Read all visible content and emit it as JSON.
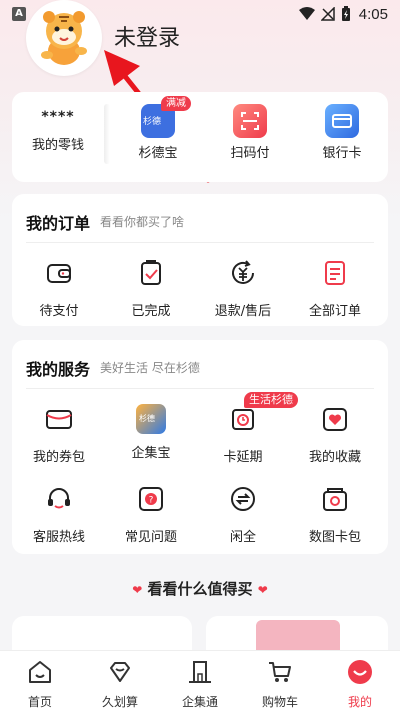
{
  "status_bar": {
    "time": "4:05",
    "left_badge": "A"
  },
  "profile": {
    "username": "未登录"
  },
  "wallet": {
    "items": [
      {
        "value": "****",
        "label": "我的零钱"
      },
      {
        "label": "杉德宝",
        "badge": "满减",
        "icon_text": "杉德"
      },
      {
        "label": "扫码付"
      },
      {
        "label": "银行卡"
      }
    ]
  },
  "orders": {
    "title": "我的订单",
    "subtitle": "看看你都买了啥",
    "items": [
      {
        "label": "待支付",
        "icon": "wallet-icon"
      },
      {
        "label": "已完成",
        "icon": "clipboard-check-icon"
      },
      {
        "label": "退款/售后",
        "icon": "refund-icon"
      },
      {
        "label": "全部订单",
        "icon": "document-list-icon"
      }
    ]
  },
  "services": {
    "title": "我的服务",
    "subtitle": "美好生活 尽在杉德",
    "items": [
      {
        "label": "我的券包",
        "icon": "coupon-icon"
      },
      {
        "label": "企集宝",
        "icon": "qijibao-icon",
        "icon_text": "杉德"
      },
      {
        "label": "卡延期",
        "icon": "card-extend-icon",
        "badge": "生活杉德"
      },
      {
        "label": "我的收藏",
        "icon": "heart-icon"
      },
      {
        "label": "客服热线",
        "icon": "headset-icon"
      },
      {
        "label": "常见问题",
        "icon": "faq-icon"
      },
      {
        "label": "闲全",
        "icon": "exchange-icon"
      },
      {
        "label": "数图卡包",
        "icon": "card-wallet-icon"
      }
    ]
  },
  "recommend": {
    "title": "看看什么值得买"
  },
  "tabbar": {
    "items": [
      {
        "label": "首页",
        "icon": "home-icon"
      },
      {
        "label": "久划算",
        "icon": "diamond-icon"
      },
      {
        "label": "企集通",
        "icon": "building-icon"
      },
      {
        "label": "购物车",
        "icon": "cart-icon"
      },
      {
        "label": "我的",
        "icon": "profile-icon",
        "active": true
      }
    ]
  },
  "colors": {
    "accent": "#ef3b4b",
    "background": "#f5f5f7"
  }
}
